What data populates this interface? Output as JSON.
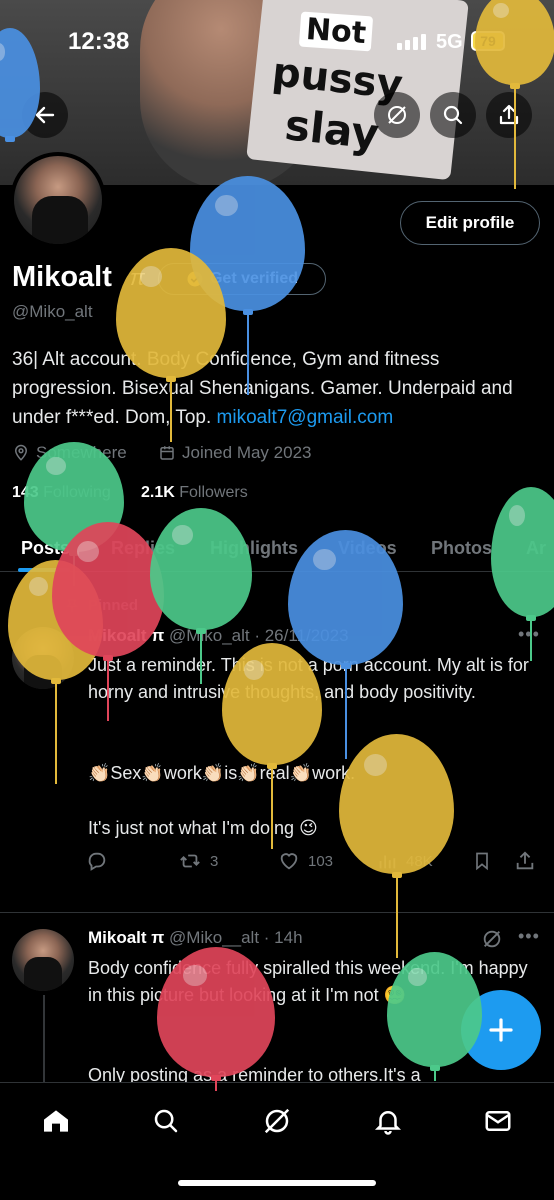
{
  "status_bar": {
    "time": "12:38",
    "network": "5G",
    "battery": "79"
  },
  "banner": {
    "sign_word_1": "Not",
    "sign_word_2": "pussy",
    "sign_word_3": "slay"
  },
  "profile": {
    "name": "Mikoalt",
    "name_symbol": "π",
    "handle": "@Miko_alt",
    "get_verified_label": "Get verified",
    "edit_profile_label": "Edit profile",
    "bio_text": "36| Alt account. Body Confidence, Gym and fitness progression. Bisexual Shenanigans. Gamer. Underpaid and under f***ed. Dom, Top. ",
    "bio_email": "mikoalt7@gmail.com",
    "location": "Somewhere",
    "joined": "Joined May 2023",
    "following_count": "143",
    "following_label": "Following",
    "followers_count": "2.1K",
    "followers_label": "Followers"
  },
  "tabs": [
    "Posts",
    "Replies",
    "Highlights",
    "Videos",
    "Photos",
    "Ar"
  ],
  "posts": [
    {
      "pinned_label": "Pinned",
      "author": "Mikoalt π",
      "handle_time": "@Miko_alt · 26/11/2023",
      "lines": [
        "Just a reminder. This is not a porn account. My alt is for horny and intrusive thoughts, and body positivity.",
        "👏🏻Sex👏🏻work👏🏻is👏🏻real👏🏻work.",
        "It's just not what I'm doing 😉"
      ],
      "reposts": "3",
      "likes": "103",
      "views": "48K"
    },
    {
      "author": "Mikoalt π",
      "handle_time": "@Miko__alt · 14h",
      "lines": [
        "Body confidence fully spiralled this weekend. I'm happy in this picture but looking at it I'm not 😵‍💫",
        "Only posting as a reminder to others.It's a"
      ]
    }
  ],
  "icons": [
    "back-arrow-icon",
    "grok-icon",
    "search-icon",
    "share-icon",
    "location-icon",
    "calendar-icon",
    "pin-icon",
    "more-icon",
    "reply-icon",
    "repost-icon",
    "like-icon",
    "views-icon",
    "bookmark-icon",
    "home-icon",
    "notifications-icon",
    "messages-icon",
    "compose-icon"
  ],
  "colors": {
    "accent": "#1d9bf0",
    "muted": "#71767b",
    "balloon_blue": "#4a90e2",
    "balloon_yellow": "#e2b93b",
    "balloon_green": "#4cc98a",
    "balloon_red": "#e0455a"
  }
}
